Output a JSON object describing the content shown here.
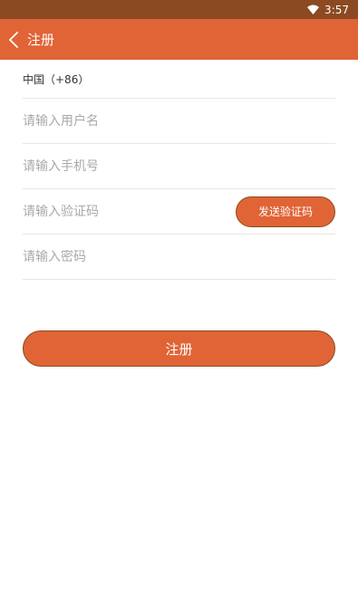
{
  "status_bar": {
    "time": "3:57",
    "icons": [
      "wifi-icon"
    ]
  },
  "app_bar": {
    "back_icon": "chevron-left-icon",
    "title": "注册"
  },
  "form": {
    "country": "中国（+86）",
    "username": {
      "value": "",
      "placeholder": "请输入用户名"
    },
    "phone": {
      "value": "",
      "placeholder": "请输入手机号"
    },
    "verification_code": {
      "value": "",
      "placeholder": "请输入验证码"
    },
    "send_code_label": "发送验证码",
    "password": {
      "value": "",
      "placeholder": "请输入密码"
    },
    "submit_label": "注册"
  },
  "colors": {
    "status_bar": "#8b4a22",
    "accent": "#e06436",
    "button_border": "#8b4a22",
    "divider": "#e9e6e3",
    "placeholder": "#a9a9a9"
  }
}
